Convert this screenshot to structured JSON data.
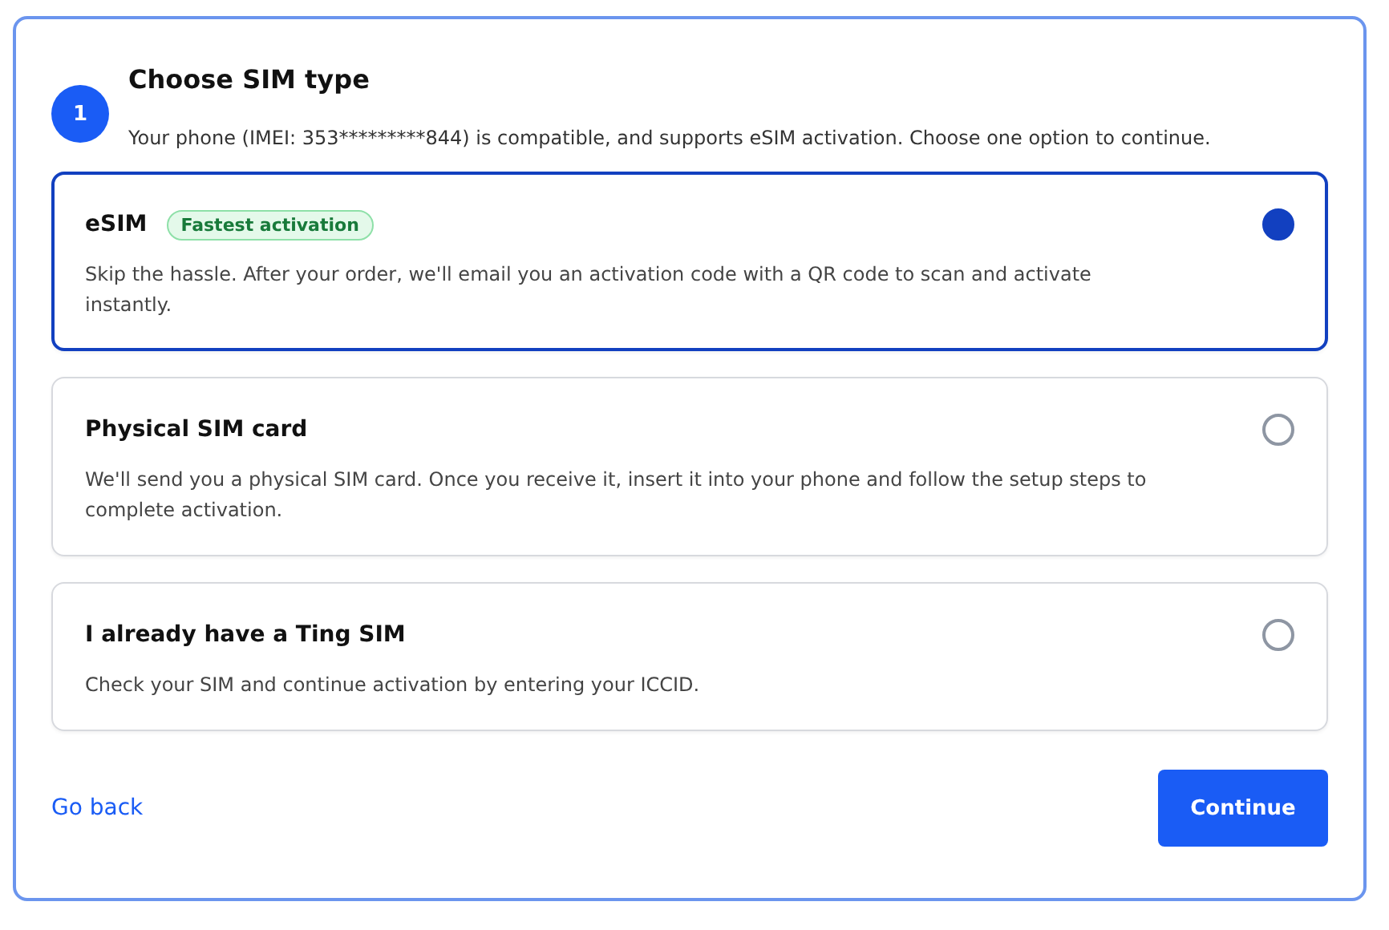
{
  "step": {
    "number": "1",
    "title": "Choose SIM type",
    "description": "Your phone (IMEI: 353*********844) is compatible, and supports eSIM activation. Choose one option to continue."
  },
  "options": [
    {
      "title": "eSIM",
      "badge": "Fastest activation",
      "description": "Skip the hassle. After your order, we'll email you an activation code with a QR code to scan and activate instantly.",
      "selected": true
    },
    {
      "title": "Physical SIM card",
      "description": "We'll send you a physical SIM card. Once you receive it, insert it into your phone and follow the setup steps to complete activation.",
      "selected": false
    },
    {
      "title": "I already have a Ting SIM",
      "description": "Check your SIM and continue activation by entering your ICCID.",
      "selected": false
    }
  ],
  "back_link": "Go back",
  "continue_button": "Continue"
}
